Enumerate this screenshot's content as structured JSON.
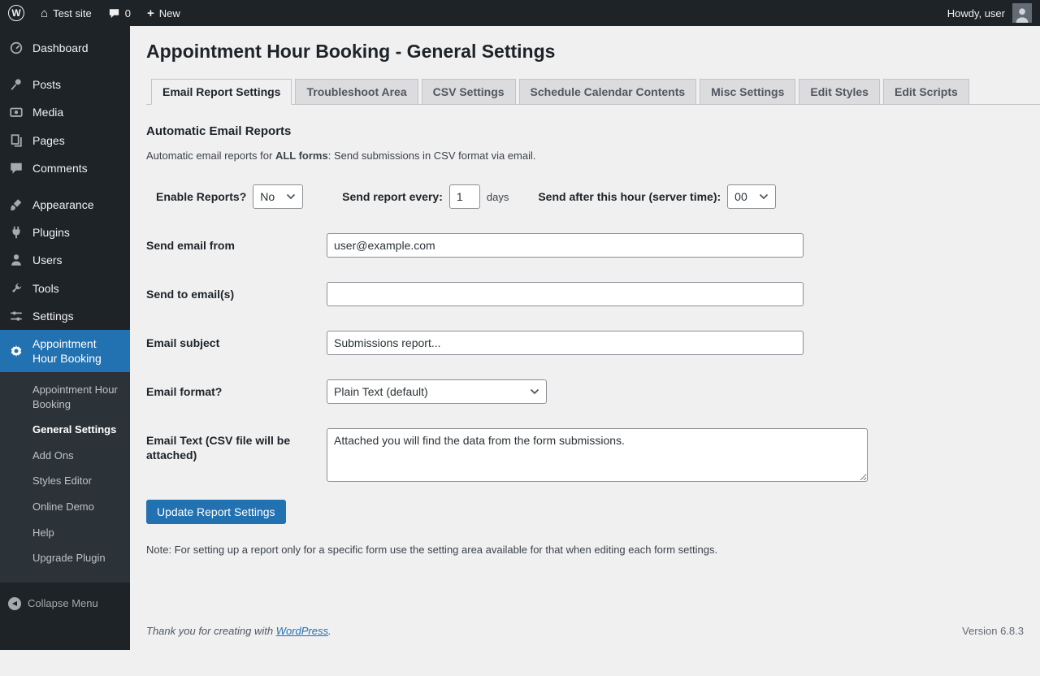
{
  "colors": {
    "accent": "#2271b1",
    "chrome": "#1d2327"
  },
  "icons": {
    "wp_logo": "W",
    "home": "⌂",
    "plus": "+",
    "collapse_arrow": "◀"
  },
  "admin_bar": {
    "site_name": "Test site",
    "comments_count": "0",
    "new_label": "New",
    "howdy": "Howdy, user"
  },
  "sidebar": {
    "items": [
      {
        "label": "Dashboard"
      },
      {
        "label": "Posts"
      },
      {
        "label": "Media"
      },
      {
        "label": "Pages"
      },
      {
        "label": "Comments"
      },
      {
        "label": "Appearance"
      },
      {
        "label": "Plugins"
      },
      {
        "label": "Users"
      },
      {
        "label": "Tools"
      },
      {
        "label": "Settings"
      },
      {
        "label": "Appointment Hour Booking",
        "active": true
      }
    ],
    "submenu": [
      "Appointment Hour Booking",
      "General Settings",
      "Add Ons",
      "Styles Editor",
      "Online Demo",
      "Help",
      "Upgrade Plugin"
    ],
    "collapse_label": "Collapse Menu"
  },
  "page": {
    "title": "Appointment Hour Booking - General Settings",
    "tabs": [
      {
        "label": "Email Report Settings",
        "active": true
      },
      {
        "label": "Troubleshoot Area"
      },
      {
        "label": "CSV Settings"
      },
      {
        "label": "Schedule Calendar Contents"
      },
      {
        "label": "Misc Settings"
      },
      {
        "label": "Edit Styles"
      },
      {
        "label": "Edit Scripts"
      }
    ],
    "section_title": "Automatic Email Reports",
    "intro_prefix": "Automatic email reports for ",
    "intro_bold": "ALL forms",
    "intro_suffix": ": Send submissions in CSV format via email.",
    "fields": {
      "enable_label": "Enable Reports?",
      "enable_value": "No",
      "every_label": "Send report every:",
      "every_value": "1",
      "every_suffix": "days",
      "hour_label": "Send after this hour (server time):",
      "hour_value": "00",
      "from_label": "Send email from",
      "from_value": "user@example.com",
      "to_label": "Send to email(s)",
      "to_value": "",
      "subject_label": "Email subject",
      "subject_value": "Submissions report...",
      "format_label": "Email format?",
      "format_value": "Plain Text (default)",
      "text_label": "Email Text (CSV file will be attached)",
      "text_value": "Attached you will find the data from the form submissions."
    },
    "submit_label": "Update Report Settings",
    "note": "Note: For setting up a report only for a specific form use the setting area available for that when editing each form settings."
  },
  "footer": {
    "thanks_prefix": "Thank you for creating with ",
    "thanks_link": "WordPress",
    "thanks_suffix": ".",
    "version": "Version 6.8.3"
  }
}
